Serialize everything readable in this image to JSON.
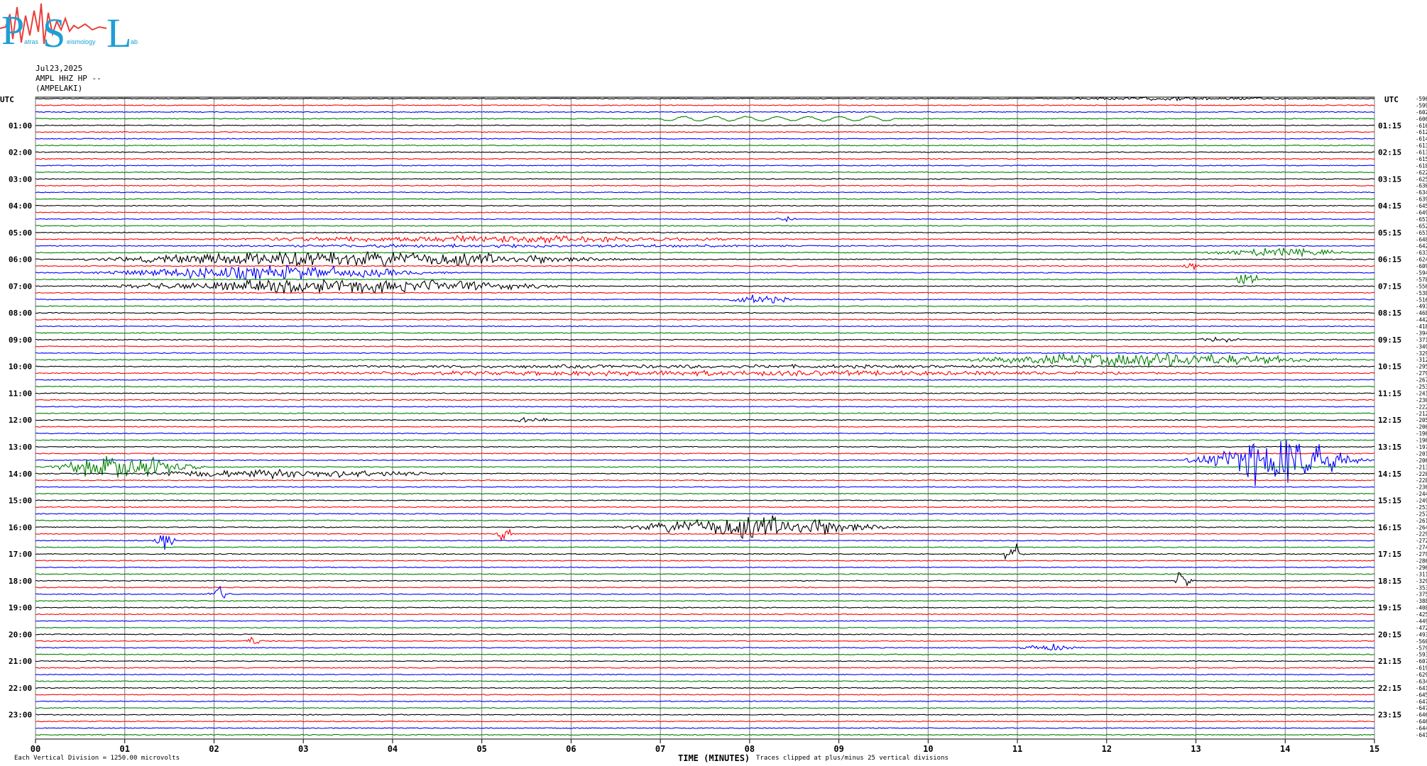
{
  "header": {
    "logo_letters": [
      "P",
      "S",
      "L"
    ],
    "logo_small": [
      "atras",
      "eismology",
      "ab"
    ],
    "date": "Jul23,2025",
    "channel": "AMPL HHZ HP --",
    "station": "(AMPELAKI)"
  },
  "colors": {
    "trace_cycle": [
      "#000000",
      "#ff0000",
      "#0000ff",
      "#008000"
    ],
    "gridline": "#7a7a7a",
    "logo_blue": "#1e9fd6",
    "logo_red": "#e8403c"
  },
  "chart_data": {
    "type": "line",
    "title": "",
    "xlabel": "TIME (MINUTES)",
    "ylabel": "UTC",
    "right_ylabel": "UTC",
    "xlim": [
      0,
      15
    ],
    "x_ticks": [
      "00",
      "01",
      "02",
      "03",
      "04",
      "05",
      "06",
      "07",
      "08",
      "09",
      "10",
      "11",
      "12",
      "13",
      "14",
      "15"
    ],
    "trace_count": 96,
    "left_hour_labels": [
      "01:00",
      "02:00",
      "03:00",
      "04:00",
      "05:00",
      "06:00",
      "07:00",
      "08:00",
      "09:00",
      "10:00",
      "11:00",
      "12:00",
      "13:00",
      "14:00",
      "15:00",
      "16:00",
      "17:00",
      "18:00",
      "19:00",
      "20:00",
      "21:00",
      "22:00",
      "23:00"
    ],
    "right_hour_labels": [
      "01:15",
      "02:15",
      "03:15",
      "04:15",
      "05:15",
      "06:15",
      "07:15",
      "08:15",
      "09:15",
      "10:15",
      "11:15",
      "12:15",
      "13:15",
      "14:15",
      "15:15",
      "16:15",
      "17:15",
      "18:15",
      "19:15",
      "20:15",
      "21:15",
      "22:15",
      "23:15"
    ],
    "trace_offsets": [
      "-5968",
      "-5996",
      "-6029",
      "-6067",
      "-6103",
      "-6127",
      "-6140",
      "-6137",
      "-6139",
      "-6154",
      "-6181",
      "-6222",
      "-6255",
      "-6301",
      "-6346",
      "-6390",
      "-6454",
      "-6494",
      "-6518",
      "-6524",
      "-6517",
      "-6481",
      "-6428",
      "-6336",
      "-6240",
      "-6090",
      "-5948",
      "-5784",
      "-5568",
      "-5385",
      "-5164",
      "-4930",
      "-4687",
      "-4429",
      "-4185",
      "-3946",
      "-3716",
      "-3499",
      "-3297",
      "-3120",
      "-2952",
      "-2793",
      "-2671",
      "-2536",
      "-2414",
      "-2302",
      "-2227",
      "-2125",
      "-2055",
      "-2006",
      "-1967",
      "-1961",
      "-1972",
      "-2015",
      "-2067",
      "-2138",
      "-2205",
      "-2280",
      "-2364",
      "-2440",
      "-2498",
      "-2539",
      "-2571",
      "-2614",
      "-2641",
      "-2295",
      "-2721",
      "-2749",
      "-2797",
      "-2863",
      "-2966",
      "-3112",
      "-3294",
      "-3539",
      "-3750",
      "-3881",
      "-4084",
      "-4257",
      "-4495",
      "-4723",
      "-4933",
      "-5609",
      "-5799",
      "-5934",
      "-6074",
      "-6193",
      "-6295",
      "-6343",
      "-6416",
      "-6459",
      "-6478",
      "-6473",
      "-6466",
      "-6464",
      "-6443",
      "-6415"
    ],
    "events": [
      {
        "trace": 0,
        "start": 10.7,
        "end": 15,
        "amp": 2
      },
      {
        "trace": 3,
        "start": 7.0,
        "end": 9.6,
        "amp": 3,
        "kind": "wave"
      },
      {
        "trace": 18,
        "start": 8.2,
        "end": 8.6,
        "amp": 3
      },
      {
        "trace": 21,
        "start": 1.0,
        "end": 9.0,
        "amp": 4
      },
      {
        "trace": 22,
        "start": 0,
        "end": 10.5,
        "amp": 2
      },
      {
        "trace": 23,
        "start": 12.9,
        "end": 15,
        "amp": 5
      },
      {
        "trace": 24,
        "start": 0,
        "end": 7.3,
        "amp": 9
      },
      {
        "trace": 25,
        "start": 12.8,
        "end": 13.1,
        "amp": 4
      },
      {
        "trace": 26,
        "start": 0.2,
        "end": 5.0,
        "amp": 8
      },
      {
        "trace": 27,
        "start": 13.3,
        "end": 13.9,
        "amp": 6
      },
      {
        "trace": 28,
        "start": 0.2,
        "end": 6.6,
        "amp": 8
      },
      {
        "trace": 30,
        "start": 7.6,
        "end": 8.6,
        "amp": 5
      },
      {
        "trace": 36,
        "start": 12.9,
        "end": 13.6,
        "amp": 3
      },
      {
        "trace": 39,
        "start": 9.8,
        "end": 15,
        "amp": 8
      },
      {
        "trace": 40,
        "start": 0,
        "end": 15,
        "amp": 2
      },
      {
        "trace": 41,
        "start": 0.4,
        "end": 15,
        "amp": 3
      },
      {
        "trace": 48,
        "start": 5.2,
        "end": 5.9,
        "amp": 3
      },
      {
        "trace": 54,
        "start": 12.8,
        "end": 15,
        "amp": 28
      },
      {
        "trace": 55,
        "start": 0,
        "end": 2.0,
        "amp": 14
      },
      {
        "trace": 56,
        "start": 0.6,
        "end": 5.0,
        "amp": 5
      },
      {
        "trace": 64,
        "start": 6.3,
        "end": 9.9,
        "amp": 13
      },
      {
        "trace": 65,
        "start": 5.1,
        "end": 5.4,
        "amp": 8
      },
      {
        "trace": 66,
        "start": 1.3,
        "end": 1.6,
        "amp": 10
      },
      {
        "trace": 68,
        "start": 10.8,
        "end": 11.1,
        "amp": 12
      },
      {
        "trace": 72,
        "start": 12.7,
        "end": 13.0,
        "amp": 10
      },
      {
        "trace": 74,
        "start": 1.9,
        "end": 2.2,
        "amp": 9
      },
      {
        "trace": 81,
        "start": 2.3,
        "end": 2.6,
        "amp": 5
      },
      {
        "trace": 82,
        "start": 10.9,
        "end": 11.8,
        "amp": 4
      }
    ]
  },
  "footer": {
    "left_note": "Each Vertical Division = 1250.00 microvolts",
    "clip_note": "Traces clipped at plus/minus 25 vertical divisions"
  }
}
